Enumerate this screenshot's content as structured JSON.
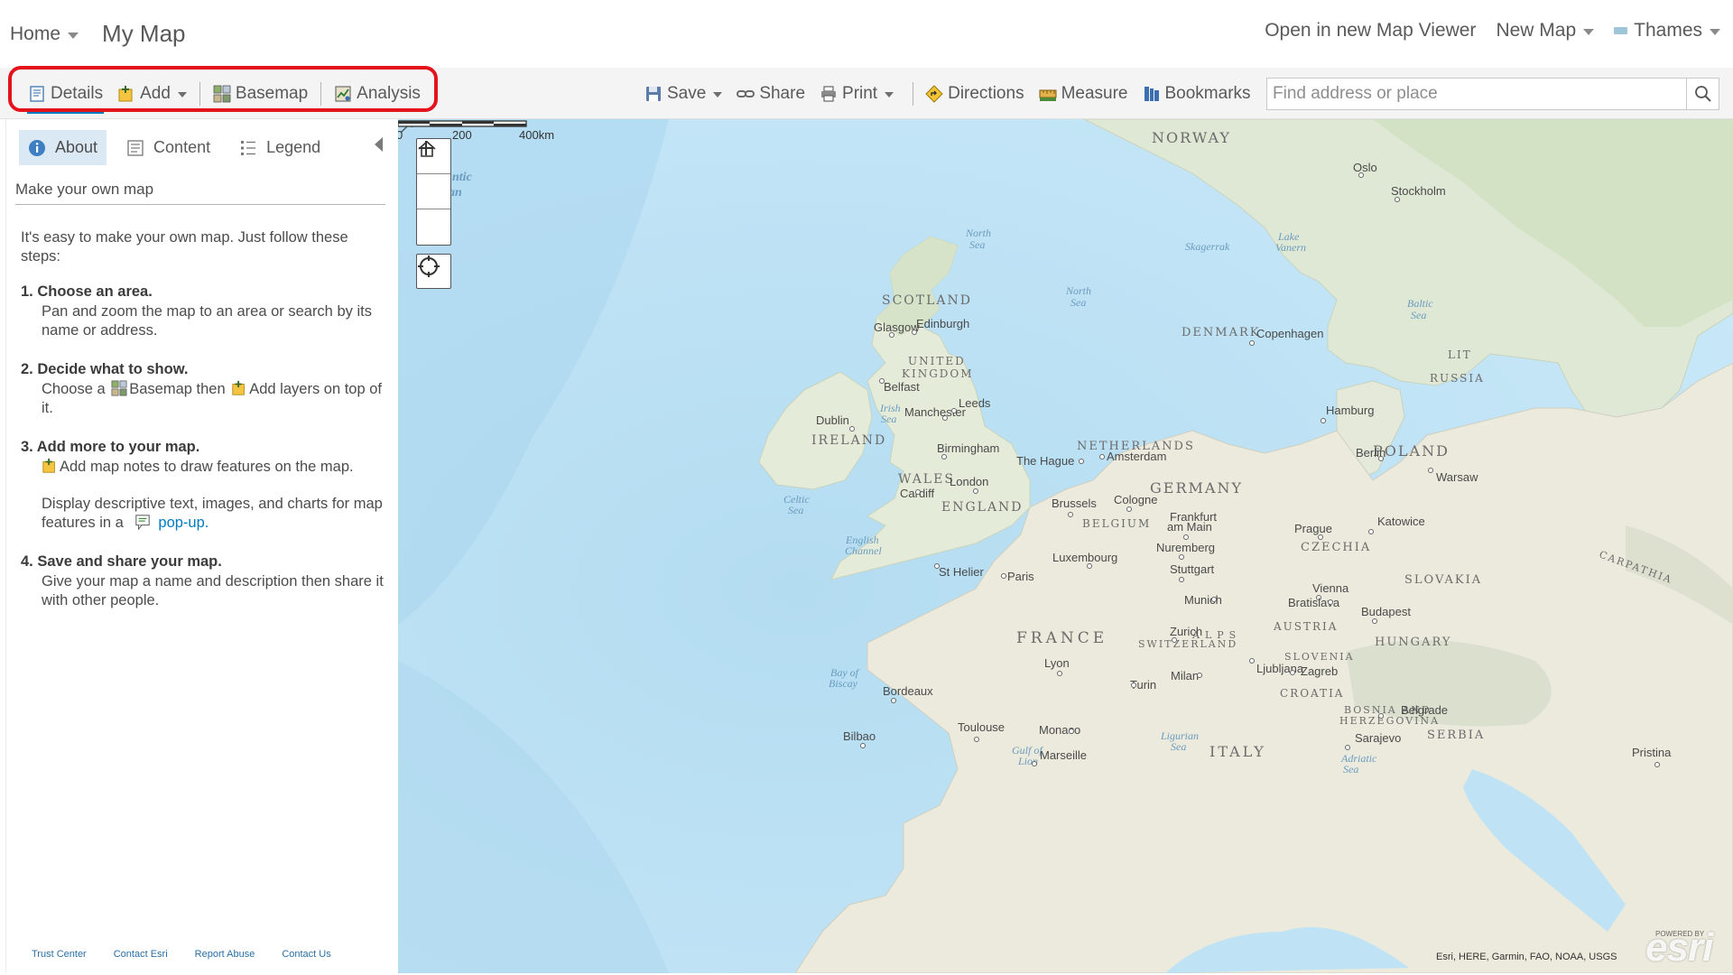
{
  "header": {
    "home_label": "Home",
    "map_title": "My Map",
    "open_new_viewer": "Open in new Map Viewer",
    "new_map": "New Map",
    "user": "Thames"
  },
  "toolbar": {
    "details": "Details",
    "add": "Add",
    "basemap": "Basemap",
    "analysis": "Analysis",
    "save": "Save",
    "share": "Share",
    "print": "Print",
    "directions": "Directions",
    "measure": "Measure",
    "bookmarks": "Bookmarks",
    "search_placeholder": "Find address or place",
    "highlight_color": "#e3121b"
  },
  "sidebar": {
    "tabs": [
      "About",
      "Content",
      "Legend"
    ],
    "subtitle": "Make your own map",
    "intro": "It's easy to make your own map. Just follow these steps:",
    "steps": [
      {
        "title": "1. Choose an area.",
        "body": "Pan and zoom the map to an area or search by its name or address."
      },
      {
        "title": "2. Decide what to show.",
        "body_pre": "Choose a",
        "body_basemap": "Basemap then",
        "body_add": "Add layers on top of it."
      },
      {
        "title": "3. Add more to your map.",
        "body": "Add map notes to draw features on the map.",
        "body2_pre": "Display descriptive text, images, and charts for map features in a",
        "body2_link": "pop-up."
      },
      {
        "title": "4. Save and share your map.",
        "body": "Give your map a name and description then share it with other people."
      }
    ],
    "footer": [
      "Trust Center",
      "Contact Esri",
      "Report Abuse",
      "Contact Us"
    ]
  },
  "map": {
    "scale_labels": [
      "0",
      "200",
      "400km"
    ],
    "attribution": "Esri, HERE, Garmin, FAO, NOAA, USGS",
    "logo": "esri",
    "powered_by": "POWERED BY",
    "labels": {
      "countries": [
        "NORWAY",
        "SCOTLAND",
        "UNITED",
        "KINGDOM",
        "IRELAND",
        "WALES",
        "ENGLAND",
        "DENMARK",
        "NETHERLANDS",
        "BELGIUM",
        "GERMANY",
        "POLAND",
        "CZECHIA",
        "SLOVAKIA",
        "AUSTRIA",
        "HUNGARY",
        "SWITZERLAND",
        "SLOVENIA",
        "CROATIA",
        "BOSNIA AND",
        "HERZEGOVINA",
        "SERBIA",
        "FRANCE",
        "ITALY",
        "RUSSIA",
        "LIT"
      ],
      "cities": [
        "Oslo",
        "Stockholm",
        "Glasgow",
        "Edinburgh",
        "Belfast",
        "Dublin",
        "Manchester",
        "Leeds",
        "Birmingham",
        "London",
        "Cardiff",
        "Copenhagen",
        "Hamburg",
        "Berlin",
        "Warsaw",
        "Amsterdam",
        "The Hague",
        "Brussels",
        "Cologne",
        "Frankfurt",
        "am Main",
        "Prague",
        "Katowice",
        "Nuremberg",
        "Stuttgart",
        "Luxembourg",
        "Paris",
        "St Helier",
        "Munich",
        "Vienna",
        "Bratislava",
        "Budapest",
        "Zurich",
        "Lyon",
        "Milan",
        "Turin",
        "Ljubljana",
        "Zagreb",
        "Belgrade",
        "Sarajevo",
        "Bordeaux",
        "Toulouse",
        "Monaco",
        "Marseille",
        "Bilbao",
        "Pristina"
      ],
      "water": [
        "North",
        "Sea",
        "North",
        "Sea",
        "Baltic",
        "Sea",
        "Lake",
        "Vanern",
        "Skagerrak",
        "Irish",
        "Sea",
        "Celtic",
        "Sea",
        "English",
        "Channel",
        "Bay of",
        "Biscay",
        "Ligurian",
        "Sea",
        "Gulf of",
        "Lion",
        "Adriatic",
        "Sea",
        "ntic",
        "an",
        "CARPATHIA",
        "ALPS"
      ]
    }
  }
}
